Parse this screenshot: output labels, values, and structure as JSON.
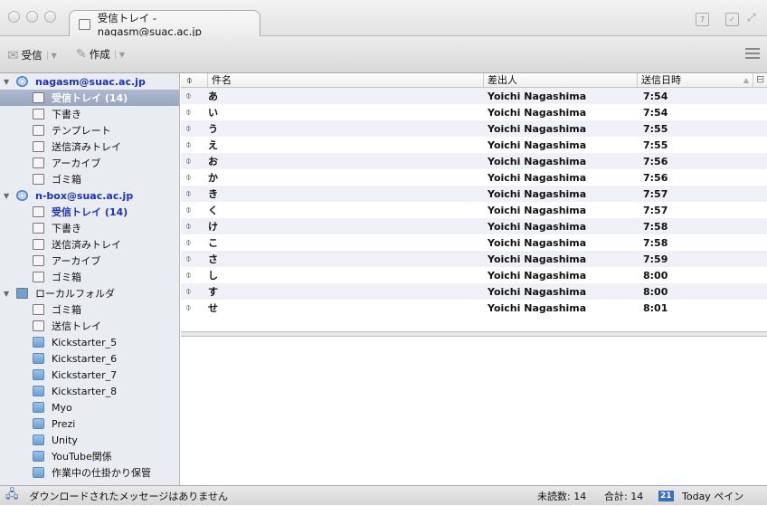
{
  "window": {
    "tab_title": "受信トレイ - nagasm@suac.ac.jp"
  },
  "toolbar": {
    "get_mail": "受信",
    "write": "作成"
  },
  "titlebar_icons": {
    "calendar": "7",
    "tasks": "✓"
  },
  "folders": [
    {
      "label": "nagasm@suac.ac.jp",
      "level": 0,
      "type": "acct",
      "twisty": true
    },
    {
      "label": "受信トレイ (14)",
      "level": 1,
      "type": "inbox",
      "selected": true
    },
    {
      "label": "下書き",
      "level": 1,
      "type": "doc"
    },
    {
      "label": "テンプレート",
      "level": 1,
      "type": "doc"
    },
    {
      "label": "送信済みトレイ",
      "level": 1,
      "type": "doc"
    },
    {
      "label": "アーカイブ",
      "level": 1,
      "type": "doc"
    },
    {
      "label": "ゴミ箱",
      "level": 1,
      "type": "doc"
    },
    {
      "label": "n-box@suac.ac.jp",
      "level": 0,
      "type": "acct",
      "twisty": true
    },
    {
      "label": "受信トレイ (14)",
      "level": 1,
      "type": "inbox",
      "unread": true
    },
    {
      "label": "下書き",
      "level": 1,
      "type": "doc"
    },
    {
      "label": "送信済みトレイ",
      "level": 1,
      "type": "doc"
    },
    {
      "label": "アーカイブ",
      "level": 1,
      "type": "doc"
    },
    {
      "label": "ゴミ箱",
      "level": 1,
      "type": "doc"
    },
    {
      "label": "ローカルフォルダ",
      "level": 0,
      "type": "local",
      "twisty": true
    },
    {
      "label": "ゴミ箱",
      "level": 1,
      "type": "doc"
    },
    {
      "label": "送信トレイ",
      "level": 1,
      "type": "inbox"
    },
    {
      "label": "Kickstarter_5",
      "level": 1,
      "type": "folder"
    },
    {
      "label": "Kickstarter_6",
      "level": 1,
      "type": "folder"
    },
    {
      "label": "Kickstarter_7",
      "level": 1,
      "type": "folder"
    },
    {
      "label": "Kickstarter_8",
      "level": 1,
      "type": "folder"
    },
    {
      "label": "Myo",
      "level": 1,
      "type": "folder"
    },
    {
      "label": "Prezi",
      "level": 1,
      "type": "folder"
    },
    {
      "label": "Unity",
      "level": 1,
      "type": "folder"
    },
    {
      "label": "YouTube関係",
      "level": 1,
      "type": "folder"
    },
    {
      "label": "作業中の仕掛かり保管",
      "level": 1,
      "type": "folder"
    }
  ],
  "columns": {
    "subject": "件名",
    "sender": "差出人",
    "date": "送信日時"
  },
  "messages": [
    {
      "subject": "あ",
      "sender": "Yoichi Nagashima",
      "date": "7:54"
    },
    {
      "subject": "い",
      "sender": "Yoichi Nagashima",
      "date": "7:54"
    },
    {
      "subject": "う",
      "sender": "Yoichi Nagashima",
      "date": "7:55"
    },
    {
      "subject": "え",
      "sender": "Yoichi Nagashima",
      "date": "7:55"
    },
    {
      "subject": "お",
      "sender": "Yoichi Nagashima",
      "date": "7:56"
    },
    {
      "subject": "か",
      "sender": "Yoichi Nagashima",
      "date": "7:56"
    },
    {
      "subject": "き",
      "sender": "Yoichi Nagashima",
      "date": "7:57"
    },
    {
      "subject": "く",
      "sender": "Yoichi Nagashima",
      "date": "7:57"
    },
    {
      "subject": "け",
      "sender": "Yoichi Nagashima",
      "date": "7:58"
    },
    {
      "subject": "こ",
      "sender": "Yoichi Nagashima",
      "date": "7:58"
    },
    {
      "subject": "さ",
      "sender": "Yoichi Nagashima",
      "date": "7:59"
    },
    {
      "subject": "し",
      "sender": "Yoichi Nagashima",
      "date": "8:00"
    },
    {
      "subject": "す",
      "sender": "Yoichi Nagashima",
      "date": "8:00"
    },
    {
      "subject": "せ",
      "sender": "Yoichi Nagashima",
      "date": "8:01"
    }
  ],
  "status": {
    "message": "ダウンロードされたメッセージはありません",
    "unread": "未読数: 14",
    "total": "合計: 14",
    "today_pane": "Today ペイン",
    "today_icon": "21"
  }
}
